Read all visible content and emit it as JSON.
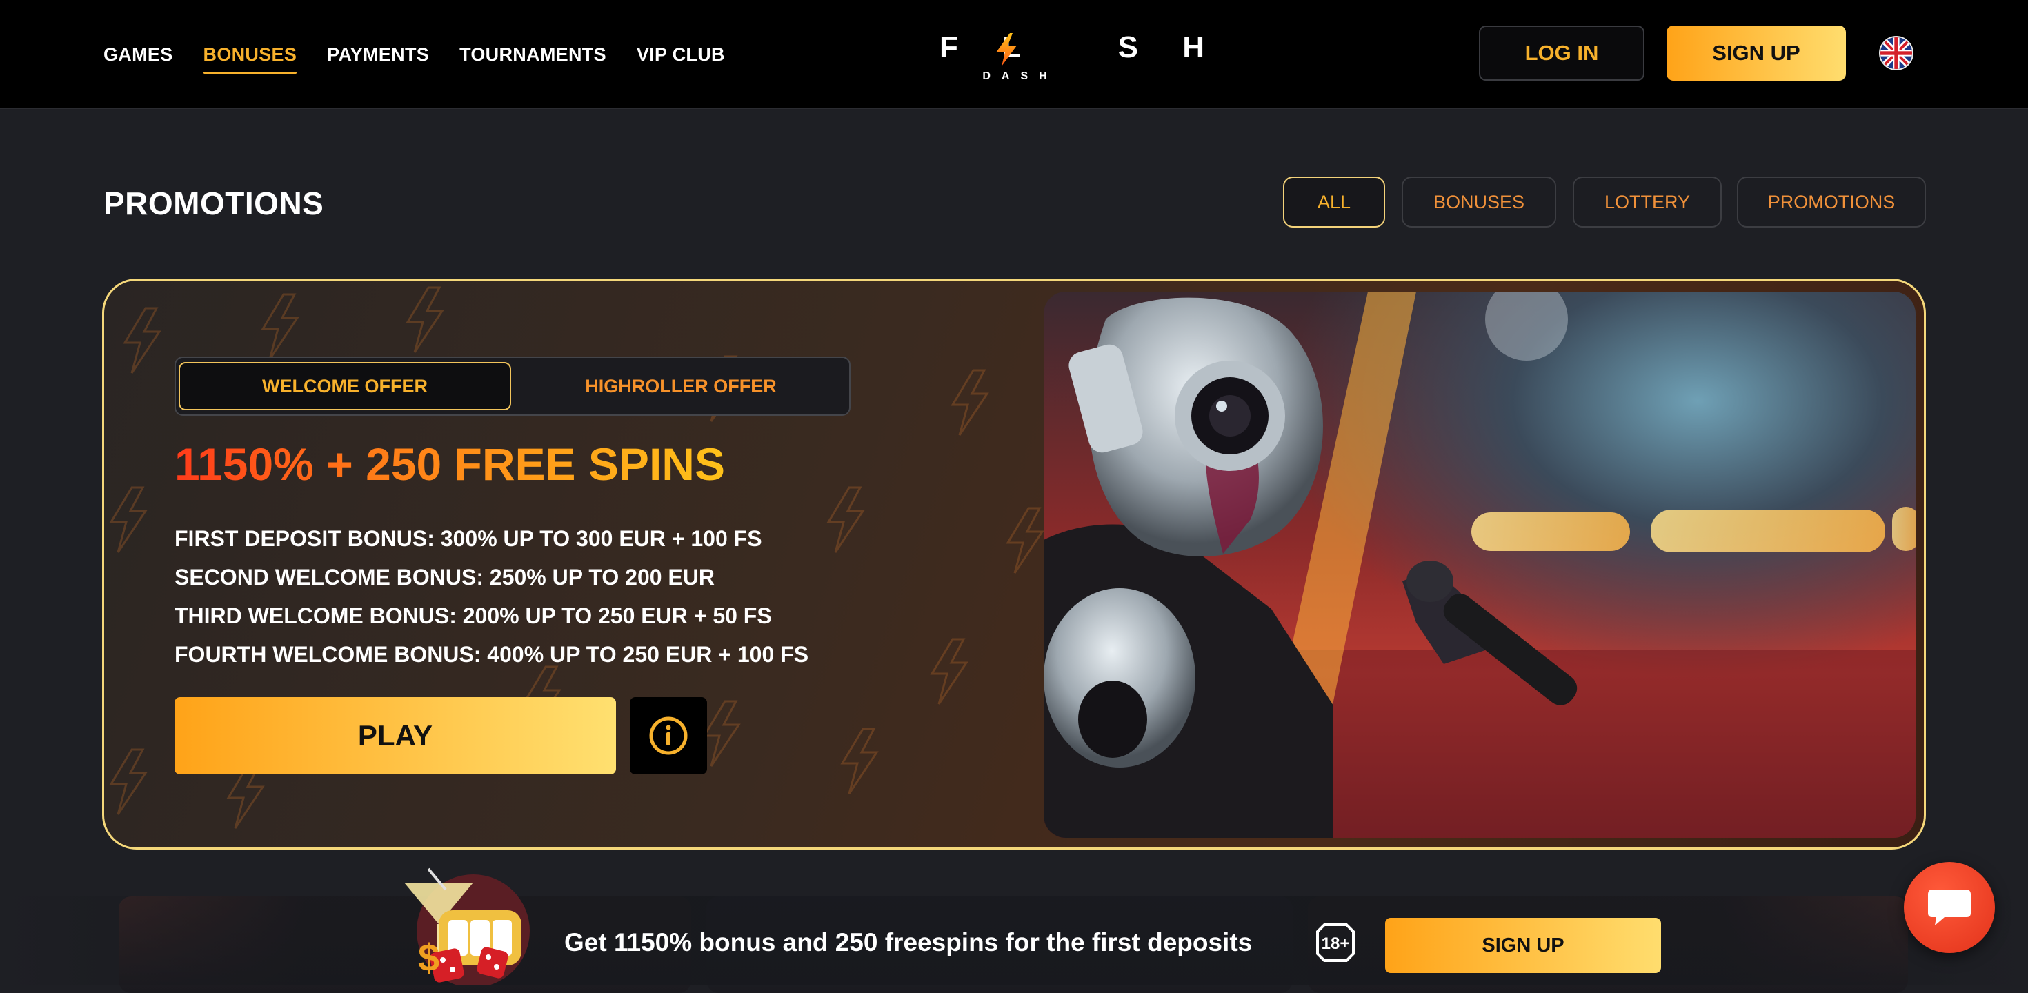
{
  "header": {
    "nav": [
      "GAMES",
      "BONUSES",
      "PAYMENTS",
      "TOURNAMENTS",
      "VIP CLUB"
    ],
    "active_nav": "BONUSES",
    "logo_text": "FL  SH",
    "logo_sub": "DASH",
    "login_label": "LOG IN",
    "signup_label": "SIGN UP",
    "language_icon": "uk-flag-icon"
  },
  "promotions": {
    "title": "PROMOTIONS",
    "filters": [
      "ALL",
      "BONUSES",
      "LOTTERY",
      "PROMOTIONS"
    ],
    "active_filter": "ALL"
  },
  "hero": {
    "tabs": [
      "WELCOME OFFER",
      "HIGHROLLER OFFER"
    ],
    "active_tab": "WELCOME OFFER",
    "headline": "1150% + 250 FREE SPINS",
    "bonus_lines": [
      "FIRST DEPOSIT BONUS: 300% UP TO 300 EUR + 100 FS",
      "SECOND WELCOME BONUS: 250% UP TO 200 EUR",
      "THIRD WELCOME BONUS: 200% UP TO 250 EUR + 50 FS",
      "FOURTH WELCOME BONUS: 400% UP TO 250 EUR + 100 FS"
    ],
    "play_label": "PLAY",
    "info_icon": "info-icon",
    "image_alt": "robot-singer-image"
  },
  "banner": {
    "text": "Get 1150% bonus and 250 freespins for the first deposits",
    "age_label": "18+",
    "signup_label": "SIGN UP"
  },
  "colors": {
    "accent": "#f7b12c",
    "accent_orange": "#f0913a",
    "header_bg": "#000000",
    "page_bg": "#1e1f24",
    "chat": "#e2321a"
  }
}
